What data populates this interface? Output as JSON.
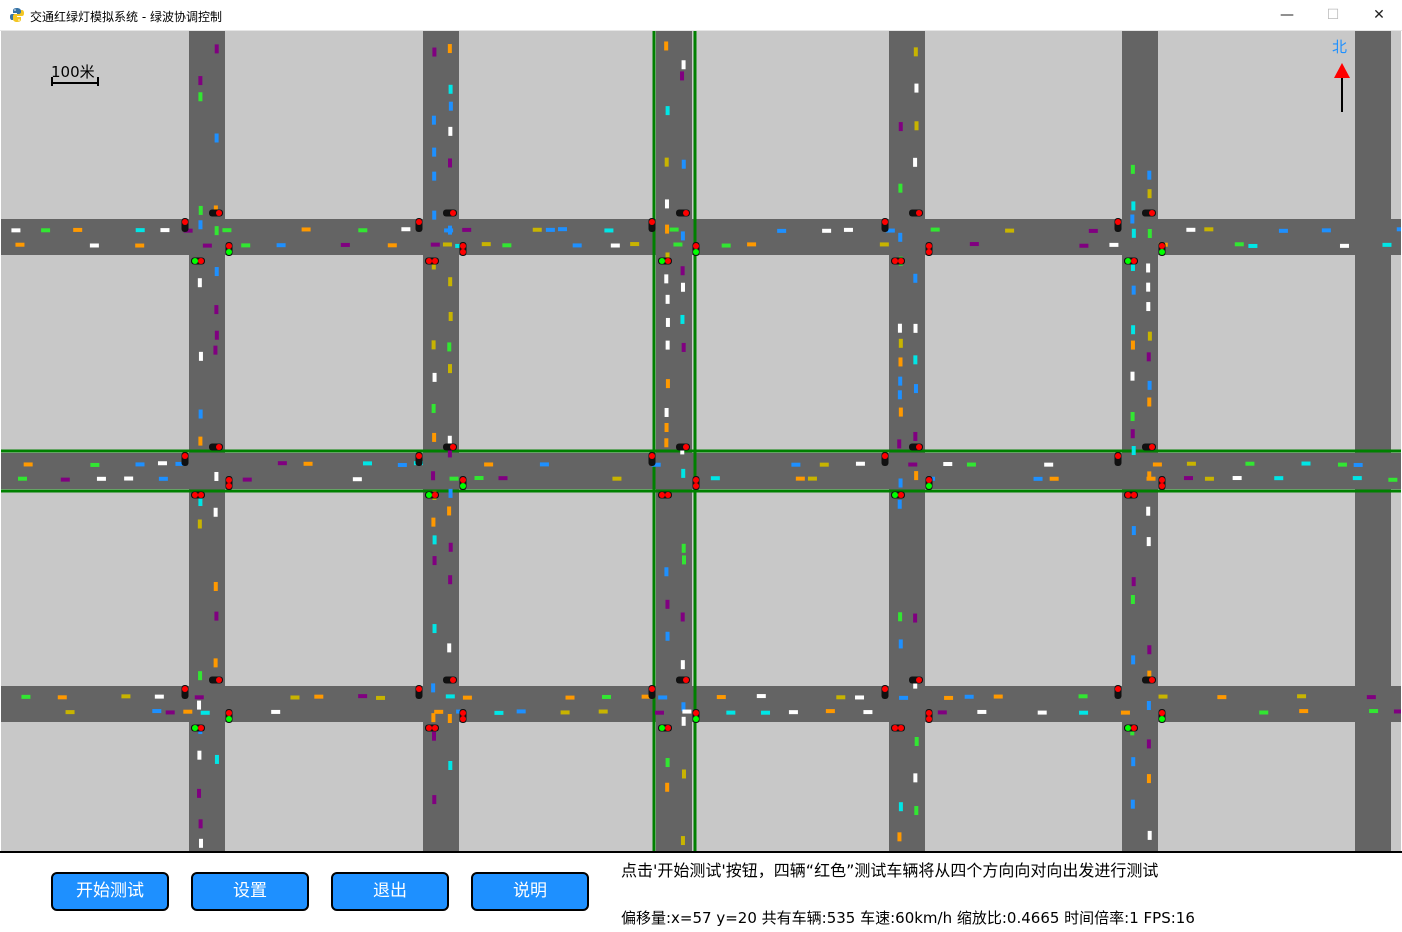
{
  "window": {
    "title": "交通红绿灯模拟系统 - 绿波协调控制",
    "minimize_glyph": "—",
    "maximize_glyph": "☐",
    "close_glyph": "✕",
    "icon": "python-app-icon"
  },
  "map": {
    "scale_label": "100米",
    "north_label": "北",
    "colors": {
      "block": "#c8c8c8",
      "road": "#646464",
      "green_wave": "#008000",
      "signal_red": "#ff0000",
      "signal_green": "#00ff00",
      "north_arrow": "#ff0000",
      "north_label": "#1e90ff"
    },
    "vehicle_colors": [
      "#ff9900",
      "#00e6e6",
      "#1e90ff",
      "#ffffff",
      "#800080",
      "#32e632",
      "#c8b400"
    ]
  },
  "controls": {
    "start_label": "开始测试",
    "settings_label": "设置",
    "exit_label": "退出",
    "help_label": "说明",
    "button_color": "#1e90ff"
  },
  "info": {
    "hint": "点击'开始测试'按钮，四辆“红色”测试车辆将从四个方向向对向出发进行测试",
    "status": "偏移量:x=57 y=20 共有车辆:535 车速:60km/h 缩放比:0.4665 时间倍率:1 FPS:16"
  }
}
